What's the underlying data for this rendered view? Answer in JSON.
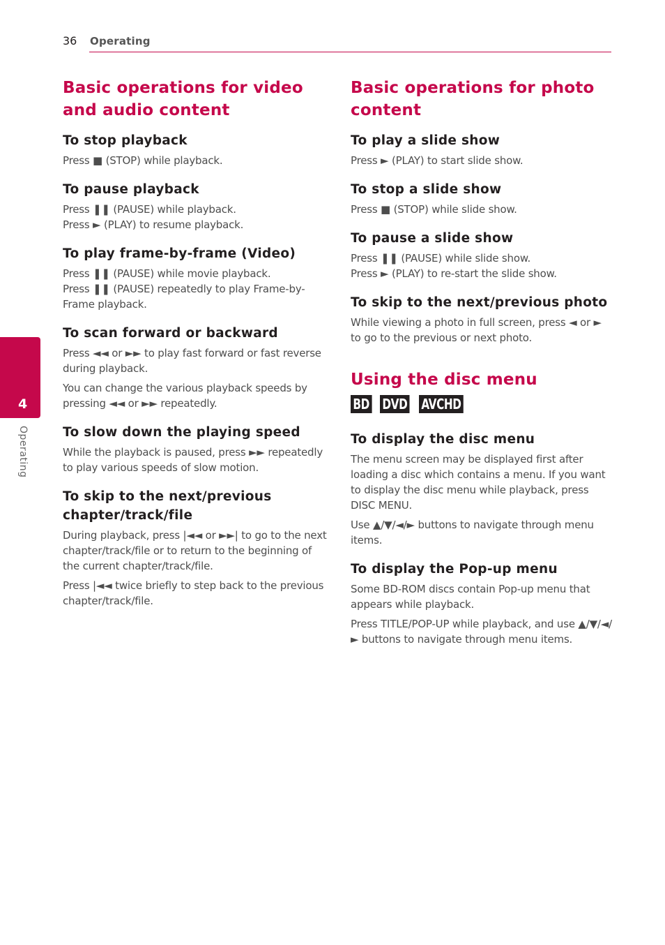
{
  "header": {
    "page_number": "36",
    "running_head": "Operating"
  },
  "side_tab": {
    "chapter_number": "4",
    "label": "Operating"
  },
  "colors": {
    "accent": "#c5084b",
    "text": "#231f20",
    "body_text": "#4d4d4d"
  },
  "left": {
    "title": "Basic operations for video and audio content",
    "sections": [
      {
        "heading": "To stop playback",
        "paragraphs": [
          "Press ■ (STOP) while playback."
        ]
      },
      {
        "heading": "To pause playback",
        "paragraphs": [
          "Press ❚❚ (PAUSE) while playback.\nPress ► (PLAY) to resume playback."
        ]
      },
      {
        "heading": "To play frame-by-frame (Video)",
        "paragraphs": [
          "Press ❚❚ (PAUSE) while movie playback.\nPress ❚❚ (PAUSE) repeatedly to play Frame-by-Frame playback."
        ]
      },
      {
        "heading": "To scan forward or backward",
        "paragraphs": [
          "Press ◄◄ or ►► to play fast forward or fast reverse during playback.",
          "You can change the various playback speeds by pressing ◄◄ or ►► repeatedly."
        ]
      },
      {
        "heading": "To slow down the playing speed",
        "paragraphs": [
          "While the playback is paused, press ►► repeatedly to play various speeds of slow motion."
        ]
      },
      {
        "heading": "To skip to the next/previous chapter/track/file",
        "paragraphs": [
          "During playback, press |◄◄ or ►►| to go to the next chapter/track/file or to return to the beginning of the current chapter/track/file.",
          "Press |◄◄ twice briefly to step back to the previous chapter/track/file."
        ]
      }
    ]
  },
  "right": {
    "title": "Basic operations for photo content",
    "sections": [
      {
        "heading": "To play a slide show",
        "paragraphs": [
          "Press ► (PLAY) to start slide show."
        ]
      },
      {
        "heading": "To stop a slide show",
        "paragraphs": [
          "Press ■ (STOP) while slide show."
        ]
      },
      {
        "heading": "To pause a slide show",
        "paragraphs": [
          "Press ❚❚ (PAUSE) while slide show.\nPress ► (PLAY) to re-start the slide show."
        ]
      },
      {
        "heading": "To skip to the next/previous photo",
        "paragraphs": [
          "While viewing a photo in full screen, press ◄ or ► to go to the previous or next photo."
        ]
      }
    ],
    "disc_menu": {
      "title": "Using the disc menu",
      "badges": [
        "BD",
        "DVD",
        "AVCHD"
      ],
      "sections": [
        {
          "heading": "To display the disc menu",
          "paragraphs": [
            "The menu screen may be displayed first after loading a disc which contains a menu. If you want to display the disc menu while playback, press DISC MENU.",
            "Use ▲/▼/◄/► buttons to navigate through menu items."
          ]
        },
        {
          "heading": "To display the Pop-up menu",
          "paragraphs": [
            "Some BD-ROM discs contain Pop-up menu that appears while playback.",
            "Press TITLE/POP-UP while playback, and use ▲/▼/◄/► buttons to navigate through menu items."
          ]
        }
      ]
    }
  }
}
